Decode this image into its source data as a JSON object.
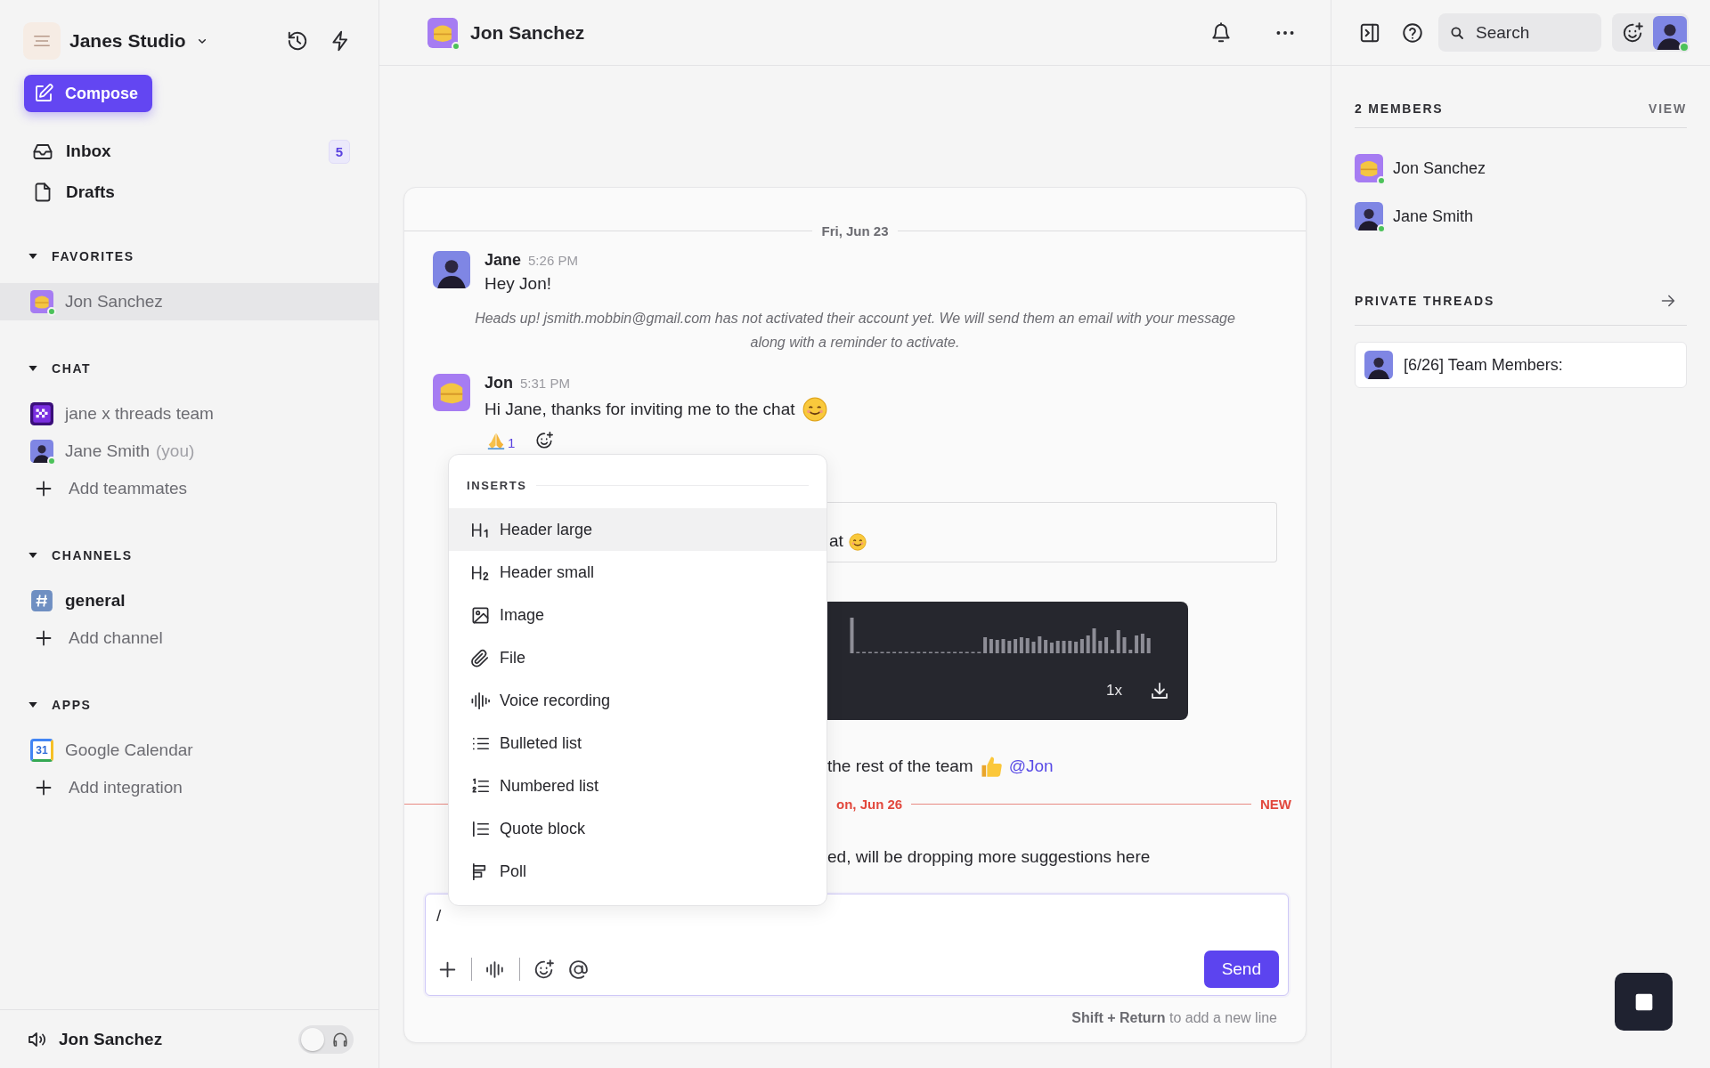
{
  "sidebar": {
    "workspace": "Janes Studio",
    "compose": "Compose",
    "nav": [
      {
        "kind": "inbox",
        "label": "Inbox",
        "badge": "5",
        "selected": false
      },
      {
        "kind": "drafts",
        "label": "Drafts",
        "selected": false
      }
    ],
    "sections": [
      {
        "title": "FAVORITES",
        "expanded": true,
        "items": [
          {
            "kind": "entry",
            "avatar": {
              "kind": "cartoon"
            },
            "label": "Jon Sanchez",
            "online": true,
            "selected": true,
            "unread": false
          }
        ]
      },
      {
        "title": "CHAT",
        "expanded": true,
        "items": [
          {
            "kind": "entry",
            "avatar": {
              "kind": "pattern"
            },
            "label": "jane x threads team",
            "online": false,
            "selected": false,
            "unread": false
          },
          {
            "kind": "entry",
            "avatar": {
              "kind": "person"
            },
            "label": "Jane Smith",
            "suffix": "(you)",
            "online": true,
            "selected": false,
            "unread": false
          },
          {
            "kind": "add",
            "label": "Add teammates",
            "selected": false
          }
        ]
      },
      {
        "title": "CHANNELS",
        "expanded": true,
        "items": [
          {
            "kind": "entry",
            "avatar": {
              "kind": "channel"
            },
            "label": "general",
            "online": false,
            "selected": false,
            "unread": true
          },
          {
            "kind": "add",
            "label": "Add channel",
            "selected": false
          }
        ]
      },
      {
        "title": "APPS",
        "expanded": true,
        "items": [
          {
            "kind": "entry",
            "avatar": {
              "kind": "calendar",
              "text": "31"
            },
            "label": "Google Calendar",
            "online": false,
            "selected": false,
            "unread": false
          },
          {
            "kind": "add",
            "label": "Add integration",
            "selected": false
          }
        ]
      }
    ],
    "footer": {
      "label": "Jon Sanchez",
      "toggle_on": false
    }
  },
  "conversation": {
    "title": "Jon Sanchez",
    "avatar": {
      "kind": "cartoon"
    },
    "online": true,
    "timeline": [
      {
        "kind": "divider",
        "label": "Fri, Jun 23",
        "unread": false
      },
      {
        "kind": "message",
        "avatar": {
          "kind": "person"
        },
        "author": "Jane",
        "time": "5:26 PM",
        "text": "Hey Jon!"
      },
      {
        "kind": "notice",
        "text": "Heads up! jsmith.mobbin@gmail.com has not activated their account yet. We will send them an email with your message along with a reminder to activate."
      },
      {
        "kind": "message",
        "avatar": {
          "kind": "cartoon"
        },
        "author": "Jon",
        "time": "5:31 PM",
        "text": "Hi Jane, thanks for inviting me to the chat",
        "emoji": {
          "kind": "smile"
        }
      },
      {
        "kind": "reactions",
        "items": [
          {
            "emoji": {
              "kind": "pray"
            },
            "count": "1"
          }
        ]
      },
      {
        "kind": "quote",
        "text": "at",
        "emoji": {
          "kind": "smile"
        }
      },
      {
        "kind": "voice",
        "speed": "1x"
      },
      {
        "kind": "fragment",
        "text": "the rest of the team",
        "emoji": {
          "kind": "thumbs"
        },
        "mention": "@Jon"
      },
      {
        "kind": "divider",
        "label": "on, Jun 26",
        "badge": "NEW",
        "unread": true
      },
      {
        "kind": "fragment",
        "text": "ed, will be dropping more suggestions here"
      }
    ],
    "menu": {
      "title": "INSERTS",
      "items": [
        {
          "kind": "h1",
          "label": "Header large",
          "selected": true
        },
        {
          "kind": "h2",
          "label": "Header small",
          "selected": false
        },
        {
          "kind": "image",
          "label": "Image",
          "selected": false
        },
        {
          "kind": "file",
          "label": "File",
          "selected": false
        },
        {
          "kind": "voice",
          "label": "Voice recording",
          "selected": false
        },
        {
          "kind": "bulleted",
          "label": "Bulleted list",
          "selected": false
        },
        {
          "kind": "numbered",
          "label": "Numbered list",
          "selected": false
        },
        {
          "kind": "quote",
          "label": "Quote block",
          "selected": false
        },
        {
          "kind": "poll",
          "label": "Poll",
          "selected": false
        }
      ]
    },
    "composer": {
      "value": "/",
      "send": "Send",
      "hint": "**Shift + Return** to add a new line"
    }
  },
  "details": {
    "search": {
      "placeholder": "Search"
    },
    "user_online": true,
    "members_title": "2 MEMBERS",
    "view": "VIEW",
    "members": [
      {
        "avatar": {
          "kind": "cartoon"
        },
        "name": "Jon Sanchez",
        "online": true
      },
      {
        "avatar": {
          "kind": "person"
        },
        "name": "Jane Smith",
        "online": true
      }
    ],
    "threads_title": "PRIVATE THREADS",
    "threads": [
      {
        "avatar": {
          "kind": "person"
        },
        "title": "[6/26] Team Members:"
      }
    ]
  }
}
